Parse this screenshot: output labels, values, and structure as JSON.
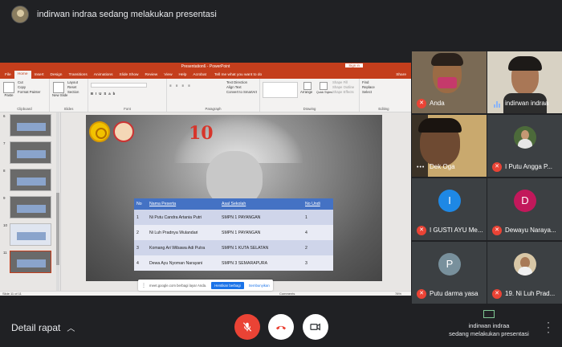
{
  "header": {
    "title": "indirwan indraa sedang melakukan presentasi"
  },
  "powerpoint": {
    "title": "Presentation6 - PowerPoint",
    "signin": "Sign in",
    "tabs": [
      "File",
      "Home",
      "Insert",
      "Design",
      "Transitions",
      "Animations",
      "Slide Show",
      "Review",
      "View",
      "Help",
      "Acrobat"
    ],
    "active_tab": "Home",
    "tellme": "Tell me what you want to do",
    "share": "Share",
    "ribbon": {
      "paste": "Paste",
      "cut": "Cut",
      "copy": "Copy",
      "format_painter": "Format Painter",
      "clipboard": "Clipboard",
      "new_slide": "New Slide",
      "layout": "Layout",
      "reset": "Reset",
      "section": "Section",
      "slides": "Slides",
      "font": "Font",
      "text_direction": "Text Direction",
      "align_text": "Align Text",
      "convert_smartart": "Convert to SmartArt",
      "paragraph": "Paragraph",
      "drawing": "Drawing",
      "arrange": "Arrange",
      "quick_styles": "Quick Styles",
      "shape_fill": "Shape Fill",
      "shape_outline": "Shape Outline",
      "shape_effects": "Shape Effects",
      "find": "Find",
      "replace": "Replace",
      "select": "Select",
      "editing": "Editing"
    },
    "thumbnails": [
      "6",
      "7",
      "8",
      "9",
      "10",
      "11"
    ],
    "active_thumbnail": "11",
    "slide": {
      "number_graphic": "10",
      "table": {
        "headers": [
          "No",
          "Nama Peserta",
          "Asal Sekolah",
          "No Undi"
        ],
        "rows": [
          [
            "1",
            "Ni Putu Candra Artania Putri",
            "SMPN 1 PAYANGAN",
            "1"
          ],
          [
            "2",
            "Ni Luh Pradnya Wulandari",
            "SMPN 1 PAYANGAN",
            "4"
          ],
          [
            "3",
            "Komang Ari Wibawa Adi Putra",
            "SMPN 1 KUTA SELATAN",
            "2"
          ],
          [
            "4",
            "Dewa Ayu Nyoman Narayani",
            "SMPN 3 SEMARAPURA",
            "3"
          ]
        ]
      }
    },
    "status": {
      "slide_of": "Slide 11 of 11",
      "comments": "Comments",
      "zoom": "78%"
    }
  },
  "share_banner": {
    "text": "meet.google.com berbagi layar Anda.",
    "stop": "Hentikan berbagi",
    "hide": "Sembunyikan"
  },
  "participants": [
    {
      "name": "Anda",
      "muted": true,
      "type": "video"
    },
    {
      "name": "indirwan indraa",
      "muted": false,
      "type": "video"
    },
    {
      "name": "Dek Oga",
      "muted": false,
      "type": "video"
    },
    {
      "name": "I Putu Angga P...",
      "muted": true,
      "type": "avatar-photo"
    },
    {
      "name": "I GUSTI AYU Me...",
      "muted": true,
      "type": "letter",
      "letter": "I",
      "color": "#1e88e5"
    },
    {
      "name": "Dewayu Naraya...",
      "muted": true,
      "type": "letter",
      "letter": "D",
      "color": "#c2185b"
    },
    {
      "name": "Putu darma yasa",
      "muted": true,
      "type": "letter",
      "letter": "P",
      "color": "#78909c"
    },
    {
      "name": "19. Ni Luh Prad...",
      "muted": true,
      "type": "avatar-photo"
    }
  ],
  "footer": {
    "details": "Detail rapat",
    "presenter_line1": "indirwan indraa",
    "presenter_line2": "sedang melakukan presentasi"
  },
  "colors": {
    "powerpoint_accent": "#c43e1c",
    "table_header": "#4472c4",
    "end_call": "#ea4335",
    "mute_red": "#ea4335"
  }
}
